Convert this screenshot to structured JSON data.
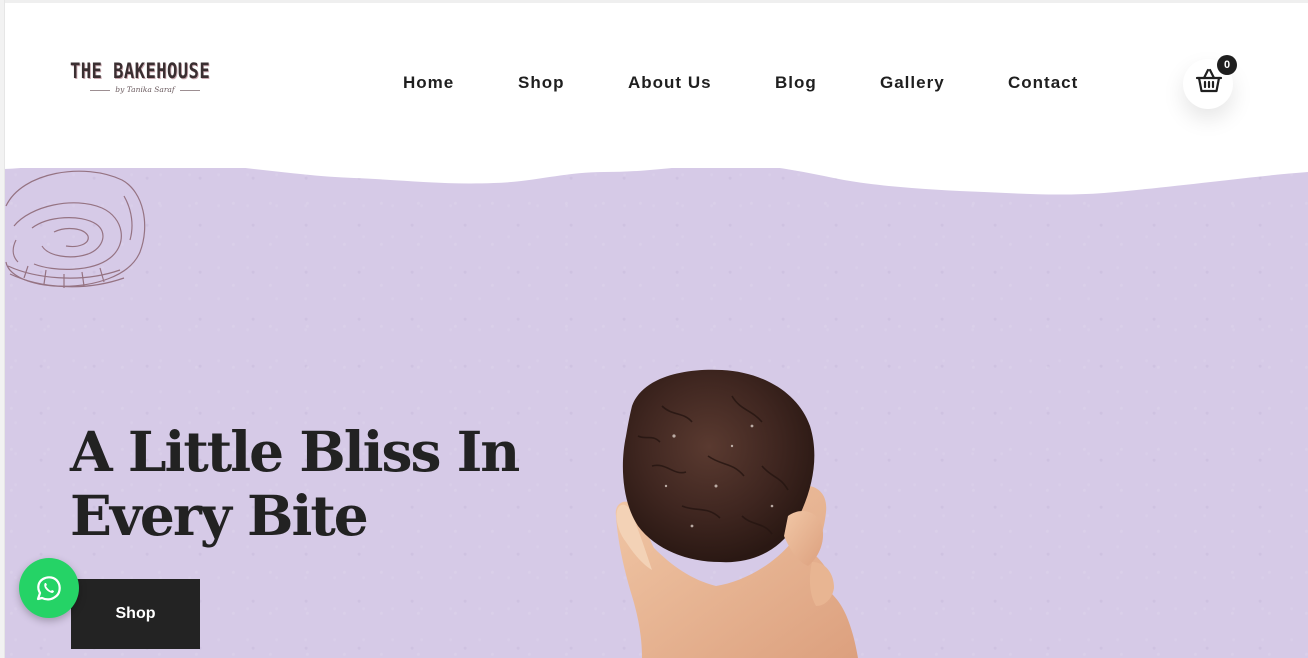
{
  "brand": {
    "title": "THE BAKEHOUSE",
    "subtitle": "by Tanika Saraf"
  },
  "nav": {
    "items": [
      {
        "label": "Home"
      },
      {
        "label": "Shop"
      },
      {
        "label": "About Us"
      },
      {
        "label": "Blog"
      },
      {
        "label": "Gallery"
      },
      {
        "label": "Contact"
      }
    ]
  },
  "cart": {
    "icon": "basket-icon",
    "count": "0"
  },
  "hero": {
    "title_line1": "A Little Bliss In",
    "title_line2": "Every Bite",
    "button_label": "Shop",
    "background_color": "#d6cae7",
    "image": "hand-holding-chocolate-cookie"
  },
  "whatsapp": {
    "icon": "whatsapp-icon",
    "color": "#25d366"
  }
}
